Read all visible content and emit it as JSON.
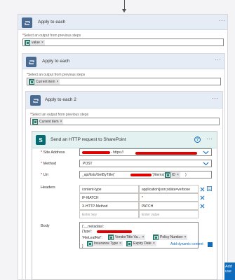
{
  "outer_loop": {
    "title": "Apply to each",
    "select_label": "Select an output from previous steps",
    "token": "value"
  },
  "mid_loop": {
    "title": "Apply to each",
    "select_label": "Select an output from previous steps",
    "token": "Current item"
  },
  "inner_loop": {
    "title": "Apply to each 2",
    "select_label": "Select an output from previous steps",
    "token": "Current item"
  },
  "action": {
    "title": "Send an HTTP request to SharePoint",
    "site_address_label": "Site Address",
    "site_address_value": "- https://",
    "method_label": "Method",
    "method_value": "POST",
    "uri_label": "Uri",
    "uri_prefix": "_api/lists/GetByTitle('",
    "uri_mid": "')/items(",
    "uri_token": "ID",
    "uri_suffix": ")",
    "headers_label": "Headers",
    "headers": [
      {
        "key": "content-type",
        "value": "application/json;odata=verbose"
      },
      {
        "key": "IF-MATCH",
        "value": "*"
      },
      {
        "key": "X-HTTP-Method",
        "value": "PATCH"
      }
    ],
    "key_placeholder": "Enter key",
    "value_placeholder": "Enter value",
    "body_label": "Body",
    "body_line1": "{'__metadata':",
    "body_line2": "{'type':",
    "body_line3": "'FileLeafRef':",
    "body_tokens_row1": [
      "VendorTitle Va...",
      "Policy Number"
    ],
    "body_tokens_row2": [
      "Insurance Type",
      "Expiry Date"
    ],
    "body_close": "}",
    "add_dynamic_label": "Add dynamic content"
  },
  "side_panel": {
    "label": "Add use"
  },
  "colors": {
    "loop_icon": "#486991",
    "sharepoint_icon": "#036c70",
    "token_icon": "#2c7a6e",
    "link_blue": "#0f6cbd",
    "redaction": "#e00000"
  }
}
